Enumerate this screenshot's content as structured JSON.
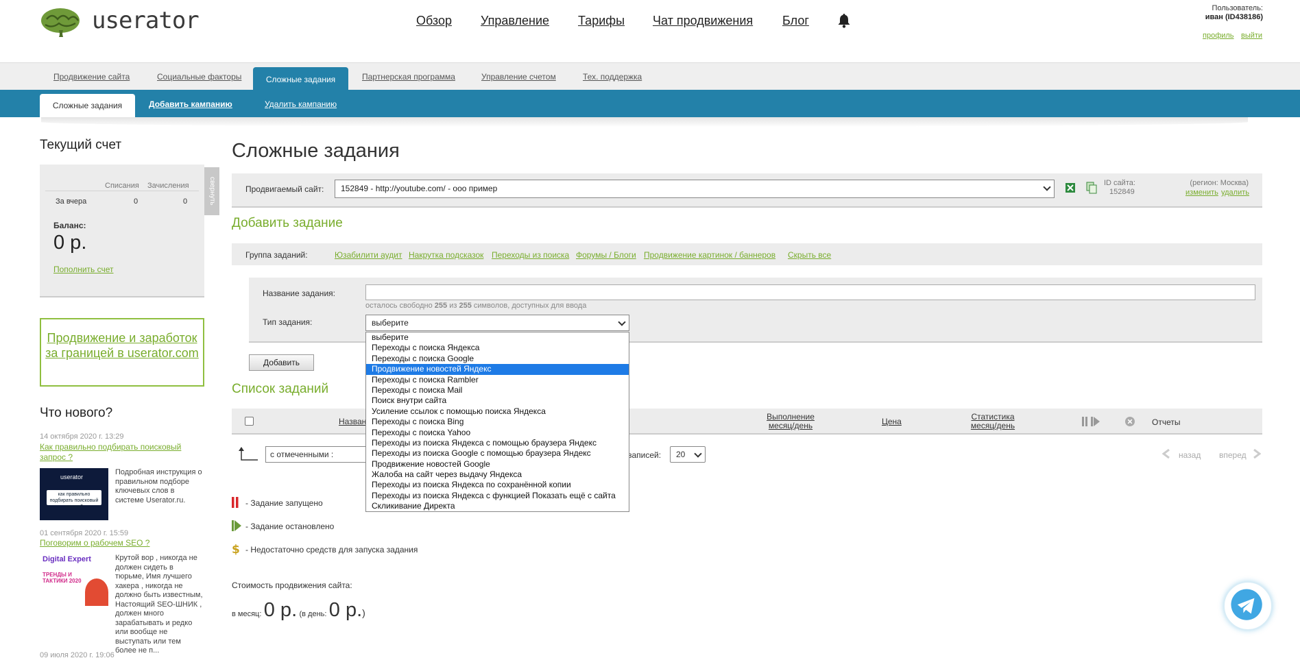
{
  "header": {
    "logo_text": "userator",
    "nav": [
      "Обзор",
      "Управление",
      "Тарифы",
      "Чат продвижения",
      "Блог"
    ],
    "user_label": "Пользователь:",
    "user_name": "иван (ID438186)",
    "profile_link": "профиль",
    "logout_link": "выйти"
  },
  "tabs": {
    "items": [
      "Продвижение сайта",
      "Социальные факторы",
      "Сложные задания",
      "Партнерская программа",
      "Управление счетом",
      "Тех. поддержка"
    ],
    "active": "Сложные задания"
  },
  "subtabs": {
    "active": "Сложные задания",
    "add": "Добавить кампанию",
    "delete": "Удалить кампанию"
  },
  "sidebar": {
    "account_title": "Текущий счет",
    "col_debit": "Списания",
    "col_credit": "Зачисления",
    "row_label": "За вчера",
    "row_debit": "0",
    "row_credit": "0",
    "collapse_label": "свернуть",
    "balance_label": "Баланс:",
    "balance_value": "0 р.",
    "topup_link": "Пополнить счет",
    "promo_text": "Продвижение и заработок за границей в userator.com",
    "news_title": "Что нового?",
    "news": [
      {
        "date": "14 октября 2020 г. 13:29",
        "title": "Как правильно подбирать поисковый запрос ?",
        "text": "Подробная инструкция о правильном подборе ключевых слов в системе Userator.ru.",
        "thumb_brand": "userator",
        "thumb_caption": "как правильно подбирать поисковый запрос?"
      },
      {
        "date": "01 сентября 2020 г. 15:59",
        "title": "Поговорим о рабочем SEO ?",
        "text": "Крутой вор , никогда не должен сидеть в тюрьме, Имя лучшего хакера , никогда не должно быть известным, Настоящий SEO-ШНИК , должен много зарабатывать и редко или вообще не выступать или тем более не п...",
        "thumb_title": "Digital Expert",
        "thumb_big": "ТРЕНДЫ И ТАКТИКИ 2020"
      },
      {
        "date": "09 июля 2020 г. 19:06"
      }
    ]
  },
  "main": {
    "title": "Сложные задания",
    "site_label": "Продвигаемый сайт:",
    "site_value": "152849 - http://youtube.com/ - ооо пример",
    "site_id_label": "ID сайта:",
    "site_id": "152849",
    "region": "(регион: Москва)",
    "edit_link": "изменить",
    "delete_link": "удалить",
    "add_task_title": "Добавить задание",
    "group_label": "Группа заданий:",
    "groups": [
      "Юзабилити аудит",
      "Накрутка подсказок",
      "Переходы из поиска",
      "Форумы / Блоги",
      "Продвижение картинок / баннеров",
      "Скрыть все"
    ],
    "name_label": "Название задания:",
    "chars_left_pre": "осталось свободно",
    "chars_left": "255",
    "chars_of": "из",
    "chars_total": "255",
    "chars_left_post": "символов, доступных для ввода",
    "type_label": "Тип задания:",
    "type_selected": "выберите",
    "type_options": [
      "выберите",
      "Переходы с поиска Яндекса",
      "Переходы с поиска Google",
      "Продвижение новостей Яндекс",
      "Переходы с поиска Rambler",
      "Переходы с поиска Mail",
      "Поиск внутри сайта",
      "Усиление ссылок с помощью поиска Яндекса",
      "Переходы с поиска Bing",
      "Переходы с поиска Yahoo",
      "Переходы из поиска Яндекса с помощью браузера Яндекс",
      "Переходы из поиска Google с помощью браузера Яндекс",
      "Продвижение новостей Google",
      "Жалоба на сайт через выдачу Яндекса",
      "Переходы из поиска Яндекса по сохранённой копии",
      "Переходы из поиска Яндекса с функцией Показать ещё с сайта",
      "Скликивание Директа"
    ],
    "highlighted_option": "Продвижение новостей Яндекс",
    "add_button": "Добавить",
    "list_title": "Список заданий",
    "col_name": "Название",
    "col_exec": "Выполнение\nмесяц/день",
    "col_price": "Цена",
    "col_stats": "Статистика\nмесяц/день",
    "col_reports": "Отчеты",
    "bulk_select": "с отмеченными :",
    "per_page_label": "записей:",
    "per_page": "20",
    "prev": "назад",
    "next": "вперед",
    "legend_running": "- Задание запущено",
    "legend_stopped": "- Задание остановлено",
    "legend_nofunds": "- Недостаточно средств для запуска задания",
    "cost_title": "Стоимость продвижения сайта:",
    "cost_month_label": "в месяц:",
    "cost_month": "0 р.",
    "cost_day_label": "(в день:",
    "cost_day": "0 р.",
    "cost_close": ")"
  },
  "colors": {
    "brand_blue": "#2381a9",
    "accent_green": "#79ad2d",
    "panel_gray": "#ececec",
    "selection_blue": "#1e7be6"
  }
}
